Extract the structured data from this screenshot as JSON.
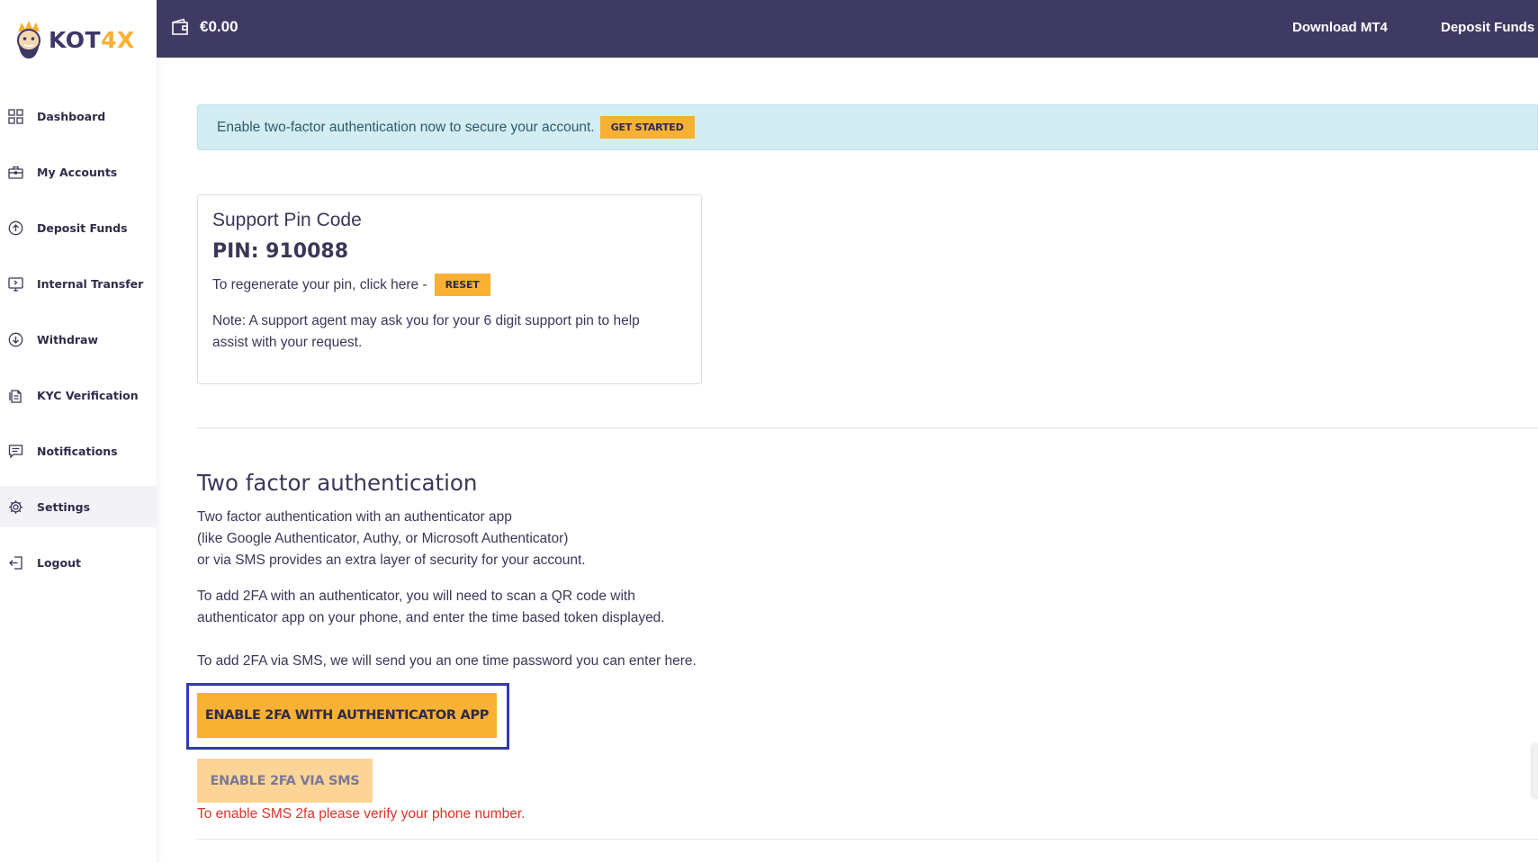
{
  "brand": {
    "logo_text_main": "KOT",
    "logo_text_accent": "4X",
    "accent_color": "#f8b133",
    "primary_color": "#3f3a63"
  },
  "sidebar": {
    "items": [
      {
        "label": "Dashboard",
        "icon": "grid-icon"
      },
      {
        "label": "My Accounts",
        "icon": "briefcase-icon"
      },
      {
        "label": "Deposit Funds",
        "icon": "arrow-up-circle-icon"
      },
      {
        "label": "Internal Transfer",
        "icon": "transfer-icon"
      },
      {
        "label": "Withdraw",
        "icon": "arrow-down-circle-icon"
      },
      {
        "label": "KYC Verification",
        "icon": "documents-icon"
      },
      {
        "label": "Notifications",
        "icon": "message-icon"
      },
      {
        "label": "Settings",
        "icon": "gear-icon",
        "active": true
      },
      {
        "label": "Logout",
        "icon": "logout-icon"
      }
    ]
  },
  "topbar": {
    "balance": "€0.00",
    "links": [
      "Download MT4",
      "Deposit Funds"
    ]
  },
  "alert": {
    "text": "Enable two-factor authentication now to secure your account.",
    "button": "GET STARTED"
  },
  "pin_card": {
    "title": "Support Pin Code",
    "pin": "PIN: 910088",
    "regen_text": "To regenerate your pin, click here -",
    "reset_button": "RESET",
    "note_line1": "Note: A support agent may ask you for your 6 digit support pin to help",
    "note_line2": "assist with your request."
  },
  "two_factor": {
    "title": "Two factor authentication",
    "intro_line1": "Two factor authentication with an authenticator app",
    "intro_line2": "(like Google Authenticator, Authy, or Microsoft Authenticator)",
    "intro_line3": "or via SMS provides an extra layer of security for your account.",
    "app_line1": "To add 2FA with an authenticator, you will need to scan a QR code with",
    "app_line2": "authenticator app on your phone, and enter the time based token displayed.",
    "sms_line": "To add 2FA via SMS, we will send you an one time password you can enter here.",
    "app_button": "ENABLE 2FA WITH AUTHENTICATOR APP",
    "sms_button": "ENABLE 2FA VIA SMS",
    "sms_warning": "To enable SMS 2fa please verify your phone number."
  }
}
